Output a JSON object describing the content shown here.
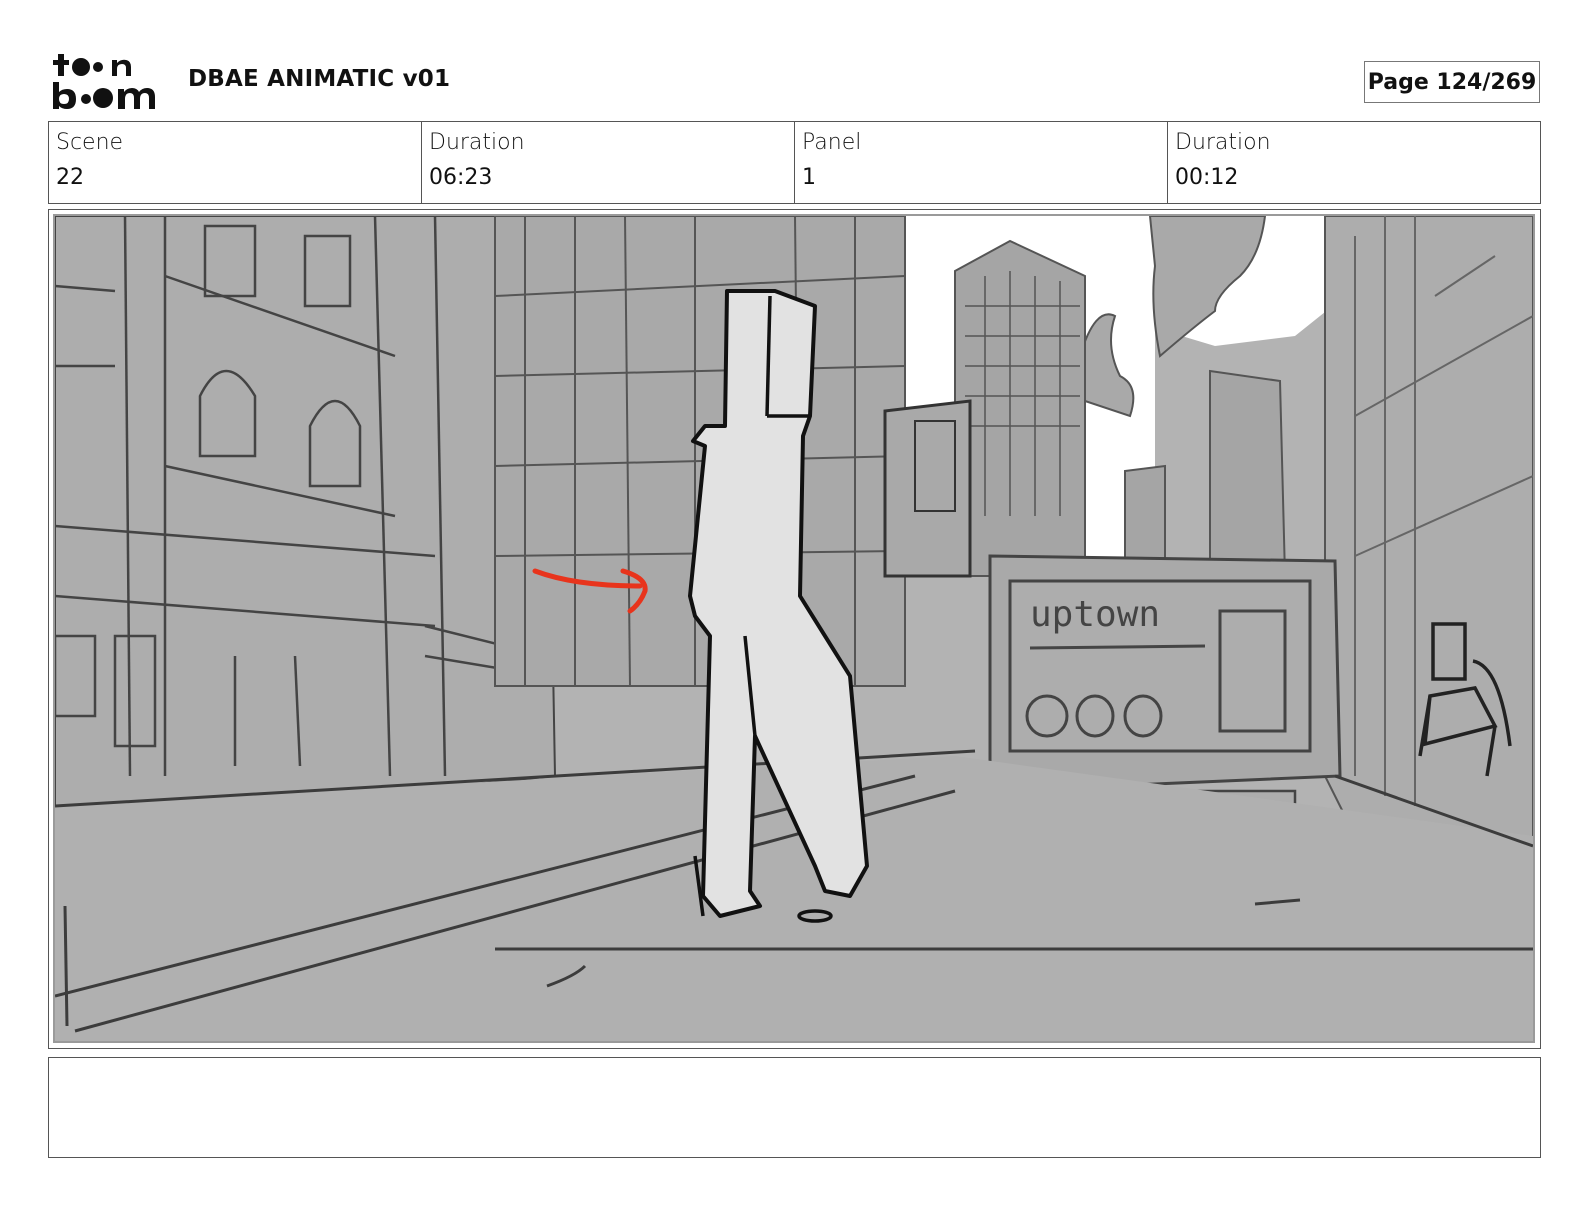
{
  "header": {
    "logo_text_top": "toon",
    "logo_text_bottom": "boom",
    "title": "DBAE ANIMATIC v01",
    "page_label": "Page 124/269"
  },
  "info": [
    {
      "label": "Scene",
      "value": "22"
    },
    {
      "label": "Duration",
      "value": "06:23"
    },
    {
      "label": "Panel",
      "value": "1"
    },
    {
      "label": "Duration",
      "value": "00:12"
    }
  ],
  "panel": {
    "sign_text": "uptown",
    "motion_arrow_color": "#e8341c",
    "sketch_fill_color": "#b3b3b3",
    "figure_fill_color": "#e2e2e2"
  },
  "notes": {
    "text": ""
  }
}
